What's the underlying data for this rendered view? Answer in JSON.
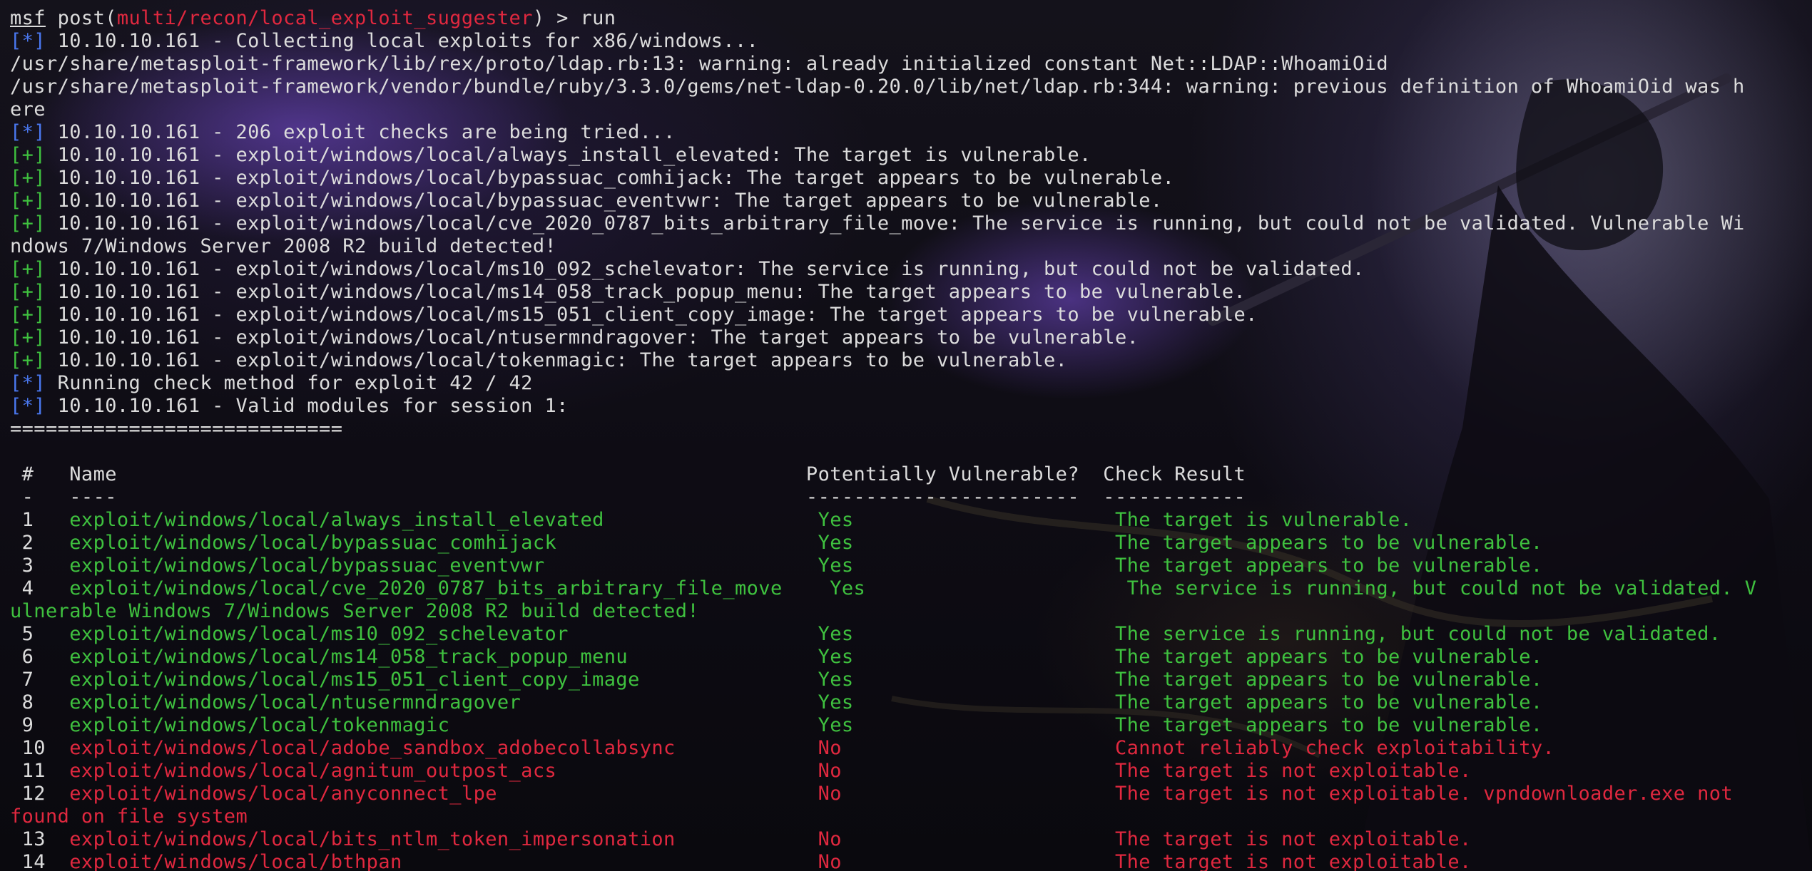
{
  "colors": {
    "text": "#dcdcdc",
    "info_marker": "#4a78f0",
    "good": "#3fc13f",
    "bad": "#e0283f"
  },
  "lines": [
    [
      {
        "t": "msf",
        "c": "white",
        "u": true
      },
      {
        "t": " post(",
        "c": "white"
      },
      {
        "t": "multi/recon/local_exploit_suggester",
        "c": "red"
      },
      {
        "t": ") > run",
        "c": "white"
      }
    ],
    [
      {
        "t": "[*]",
        "c": "blue"
      },
      {
        "t": " 10.10.10.161 - Collecting local exploits for x86/windows...",
        "c": "white"
      }
    ],
    [
      {
        "t": "/usr/share/metasploit-framework/lib/rex/proto/ldap.rb:13: warning: already initialized constant Net::LDAP::WhoamiOid",
        "c": "white"
      }
    ],
    [
      {
        "t": "/usr/share/metasploit-framework/vendor/bundle/ruby/3.3.0/gems/net-ldap-0.20.0/lib/net/ldap.rb:344: warning: previous definition of WhoamiOid was h",
        "c": "white"
      }
    ],
    [
      {
        "t": "ere",
        "c": "white"
      }
    ],
    [
      {
        "t": "[*]",
        "c": "blue"
      },
      {
        "t": " 10.10.10.161 - 206 exploit checks are being tried...",
        "c": "white"
      }
    ],
    [
      {
        "t": "[+]",
        "c": "green"
      },
      {
        "t": " 10.10.10.161 - exploit/windows/local/always_install_elevated: The target is vulnerable.",
        "c": "white"
      }
    ],
    [
      {
        "t": "[+]",
        "c": "green"
      },
      {
        "t": " 10.10.10.161 - exploit/windows/local/bypassuac_comhijack: The target appears to be vulnerable.",
        "c": "white"
      }
    ],
    [
      {
        "t": "[+]",
        "c": "green"
      },
      {
        "t": " 10.10.10.161 - exploit/windows/local/bypassuac_eventvwr: The target appears to be vulnerable.",
        "c": "white"
      }
    ],
    [
      {
        "t": "[+]",
        "c": "green"
      },
      {
        "t": " 10.10.10.161 - exploit/windows/local/cve_2020_0787_bits_arbitrary_file_move: The service is running, but could not be validated. Vulnerable Wi",
        "c": "white"
      }
    ],
    [
      {
        "t": "ndows 7/Windows Server 2008 R2 build detected!",
        "c": "white"
      }
    ],
    [
      {
        "t": "[+]",
        "c": "green"
      },
      {
        "t": " 10.10.10.161 - exploit/windows/local/ms10_092_schelevator: The service is running, but could not be validated.",
        "c": "white"
      }
    ],
    [
      {
        "t": "[+]",
        "c": "green"
      },
      {
        "t": " 10.10.10.161 - exploit/windows/local/ms14_058_track_popup_menu: The target appears to be vulnerable.",
        "c": "white"
      }
    ],
    [
      {
        "t": "[+]",
        "c": "green"
      },
      {
        "t": " 10.10.10.161 - exploit/windows/local/ms15_051_client_copy_image: The target appears to be vulnerable.",
        "c": "white"
      }
    ],
    [
      {
        "t": "[+]",
        "c": "green"
      },
      {
        "t": " 10.10.10.161 - exploit/windows/local/ntusermndragover: The target appears to be vulnerable.",
        "c": "white"
      }
    ],
    [
      {
        "t": "[+]",
        "c": "green"
      },
      {
        "t": " 10.10.10.161 - exploit/windows/local/tokenmagic: The target appears to be vulnerable.",
        "c": "white"
      }
    ],
    [
      {
        "t": "[*]",
        "c": "blue"
      },
      {
        "t": " Running check method for exploit 42 / 42",
        "c": "white"
      }
    ],
    [
      {
        "t": "[*]",
        "c": "blue"
      },
      {
        "t": " 10.10.10.161 - Valid modules for session 1:",
        "c": "white"
      }
    ],
    [
      {
        "t": "============================",
        "c": "white"
      }
    ],
    [
      {
        "t": "",
        "c": "white"
      }
    ],
    [
      {
        "t": " #   Name                                                          Potentially Vulnerable?  Check Result",
        "c": "white"
      }
    ],
    [
      {
        "t": " -   ----                                                          -----------------------  ------------",
        "c": "white"
      }
    ],
    [
      {
        "t": " 1   ",
        "c": "white"
      },
      {
        "t": "exploit/windows/local/always_install_elevated                  ",
        "c": "green"
      },
      {
        "t": "Yes                      ",
        "c": "green"
      },
      {
        "t": "The target is vulnerable.",
        "c": "green"
      }
    ],
    [
      {
        "t": " 2   ",
        "c": "white"
      },
      {
        "t": "exploit/windows/local/bypassuac_comhijack                      ",
        "c": "green"
      },
      {
        "t": "Yes                      ",
        "c": "green"
      },
      {
        "t": "The target appears to be vulnerable.",
        "c": "green"
      }
    ],
    [
      {
        "t": " 3   ",
        "c": "white"
      },
      {
        "t": "exploit/windows/local/bypassuac_eventvwr                       ",
        "c": "green"
      },
      {
        "t": "Yes                      ",
        "c": "green"
      },
      {
        "t": "The target appears to be vulnerable.",
        "c": "green"
      }
    ],
    [
      {
        "t": " 4   ",
        "c": "white"
      },
      {
        "t": "exploit/windows/local/cve_2020_0787_bits_arbitrary_file_move    ",
        "c": "green"
      },
      {
        "t": "Yes                      ",
        "c": "green"
      },
      {
        "t": "The service is running, but could not be validated. V",
        "c": "green"
      }
    ],
    [
      {
        "t": "ulnerable Windows 7/Windows Server 2008 R2 build detected!",
        "c": "green"
      }
    ],
    [
      {
        "t": " 5   ",
        "c": "white"
      },
      {
        "t": "exploit/windows/local/ms10_092_schelevator                     ",
        "c": "green"
      },
      {
        "t": "Yes                      ",
        "c": "green"
      },
      {
        "t": "The service is running, but could not be validated.",
        "c": "green"
      }
    ],
    [
      {
        "t": " 6   ",
        "c": "white"
      },
      {
        "t": "exploit/windows/local/ms14_058_track_popup_menu                ",
        "c": "green"
      },
      {
        "t": "Yes                      ",
        "c": "green"
      },
      {
        "t": "The target appears to be vulnerable.",
        "c": "green"
      }
    ],
    [
      {
        "t": " 7   ",
        "c": "white"
      },
      {
        "t": "exploit/windows/local/ms15_051_client_copy_image               ",
        "c": "green"
      },
      {
        "t": "Yes                      ",
        "c": "green"
      },
      {
        "t": "The target appears to be vulnerable.",
        "c": "green"
      }
    ],
    [
      {
        "t": " 8   ",
        "c": "white"
      },
      {
        "t": "exploit/windows/local/ntusermndragover                         ",
        "c": "green"
      },
      {
        "t": "Yes                      ",
        "c": "green"
      },
      {
        "t": "The target appears to be vulnerable.",
        "c": "green"
      }
    ],
    [
      {
        "t": " 9   ",
        "c": "white"
      },
      {
        "t": "exploit/windows/local/tokenmagic                               ",
        "c": "green"
      },
      {
        "t": "Yes                      ",
        "c": "green"
      },
      {
        "t": "The target appears to be vulnerable.",
        "c": "green"
      }
    ],
    [
      {
        "t": " 10  ",
        "c": "white"
      },
      {
        "t": "exploit/windows/local/adobe_sandbox_adobecollabsync            ",
        "c": "red"
      },
      {
        "t": "No                       ",
        "c": "red"
      },
      {
        "t": "Cannot reliably check exploitability.",
        "c": "red"
      }
    ],
    [
      {
        "t": " 11  ",
        "c": "white"
      },
      {
        "t": "exploit/windows/local/agnitum_outpost_acs                      ",
        "c": "red"
      },
      {
        "t": "No                       ",
        "c": "red"
      },
      {
        "t": "The target is not exploitable.",
        "c": "red"
      }
    ],
    [
      {
        "t": " 12  ",
        "c": "white"
      },
      {
        "t": "exploit/windows/local/anyconnect_lpe                           ",
        "c": "red"
      },
      {
        "t": "No                       ",
        "c": "red"
      },
      {
        "t": "The target is not exploitable. vpndownloader.exe not",
        "c": "red"
      }
    ],
    [
      {
        "t": "found on file system",
        "c": "red"
      }
    ],
    [
      {
        "t": " 13  ",
        "c": "white"
      },
      {
        "t": "exploit/windows/local/bits_ntlm_token_impersonation            ",
        "c": "red"
      },
      {
        "t": "No                       ",
        "c": "red"
      },
      {
        "t": "The target is not exploitable.",
        "c": "red"
      }
    ],
    [
      {
        "t": " 14  ",
        "c": "white"
      },
      {
        "t": "exploit/windows/local/bthpan                                   ",
        "c": "red"
      },
      {
        "t": "No                       ",
        "c": "red"
      },
      {
        "t": "The target is not exploitable.",
        "c": "red"
      }
    ]
  ]
}
